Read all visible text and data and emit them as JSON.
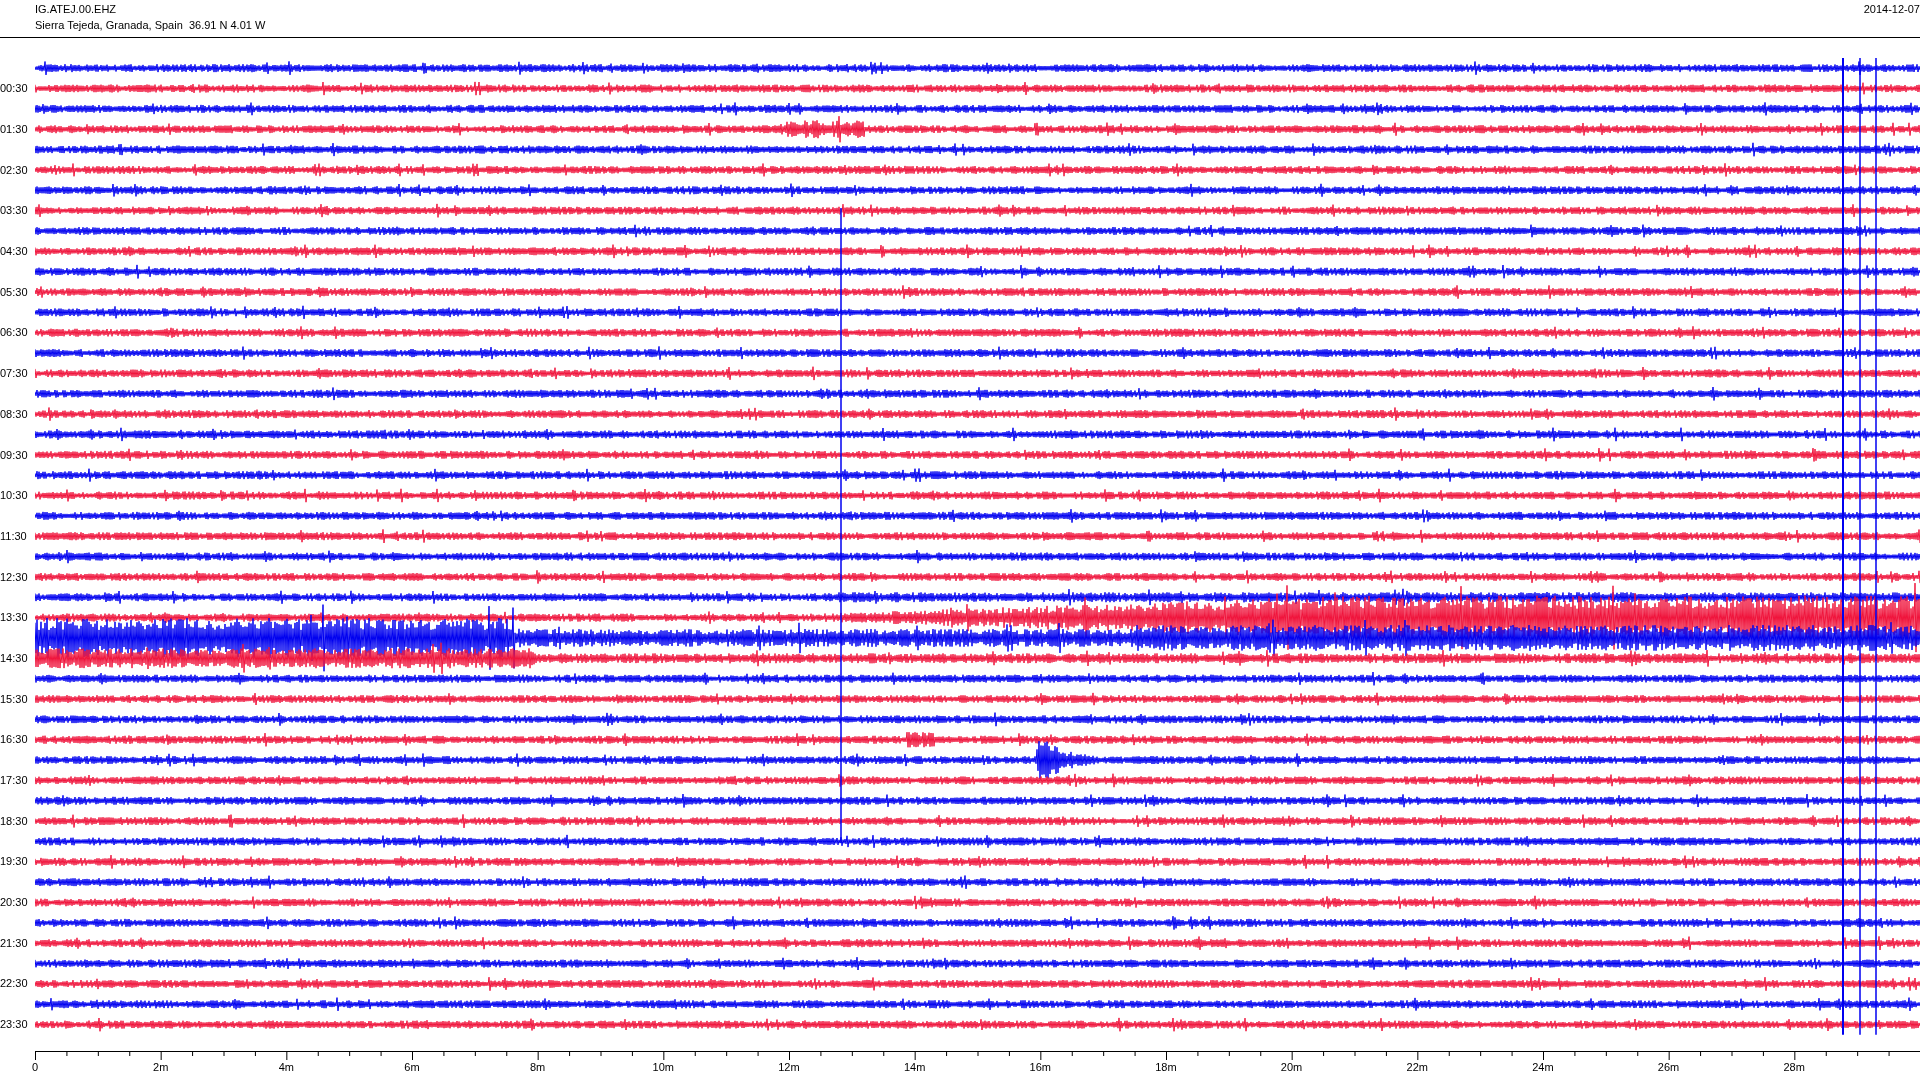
{
  "header": {
    "station": "IG.ATEJ.00.EHZ",
    "location": "Sierra Tejeda, Granada, Spain  36.91 N 4.01 W",
    "date": "2014-12-07"
  },
  "hour_labels": [
    "00:30",
    "01:30",
    "02:30",
    "03:30",
    "04:30",
    "05:30",
    "06:30",
    "07:30",
    "08:30",
    "09:30",
    "10:30",
    "11:30",
    "12:30",
    "13:30",
    "14:30",
    "15:30",
    "16:30",
    "17:30",
    "18:30",
    "19:30",
    "20:30",
    "21:30",
    "22:30",
    "23:30"
  ],
  "x_axis": {
    "labels": [
      "0",
      "2m",
      "4m",
      "6m",
      "8m",
      "10m",
      "12m",
      "14m",
      "16m",
      "18m",
      "20m",
      "22m",
      "24m",
      "26m",
      "28m"
    ]
  }
}
